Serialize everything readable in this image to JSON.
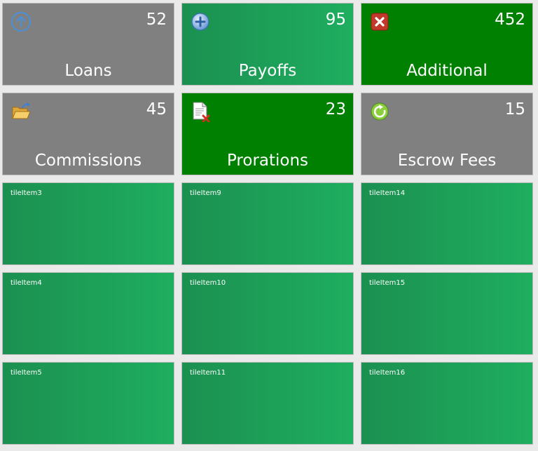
{
  "tiles": {
    "loans": {
      "label": "Loans",
      "count": "52",
      "icon": "arrow-up-circle-icon",
      "color": "#808080"
    },
    "payoffs": {
      "label": "Payoffs",
      "count": "95",
      "icon": "plus-circle-icon",
      "color": "#1fa860"
    },
    "additional": {
      "label": "Additional",
      "count": "452",
      "icon": "close-icon",
      "color": "#008000"
    },
    "commissions": {
      "label": "Commissions",
      "count": "45",
      "icon": "folder-open-icon",
      "color": "#808080"
    },
    "prorations": {
      "label": "Prorations",
      "count": "23",
      "icon": "document-delete-icon",
      "color": "#008000"
    },
    "escrow": {
      "label": "Escrow Fees",
      "count": "15",
      "icon": "refresh-icon",
      "color": "#808080"
    }
  },
  "empty_tiles": [
    "tileItem3",
    "tileItem9",
    "tileItem14",
    "tileItem4",
    "tileItem10",
    "tileItem15",
    "tileItem5",
    "tileItem11",
    "tileItem16"
  ]
}
